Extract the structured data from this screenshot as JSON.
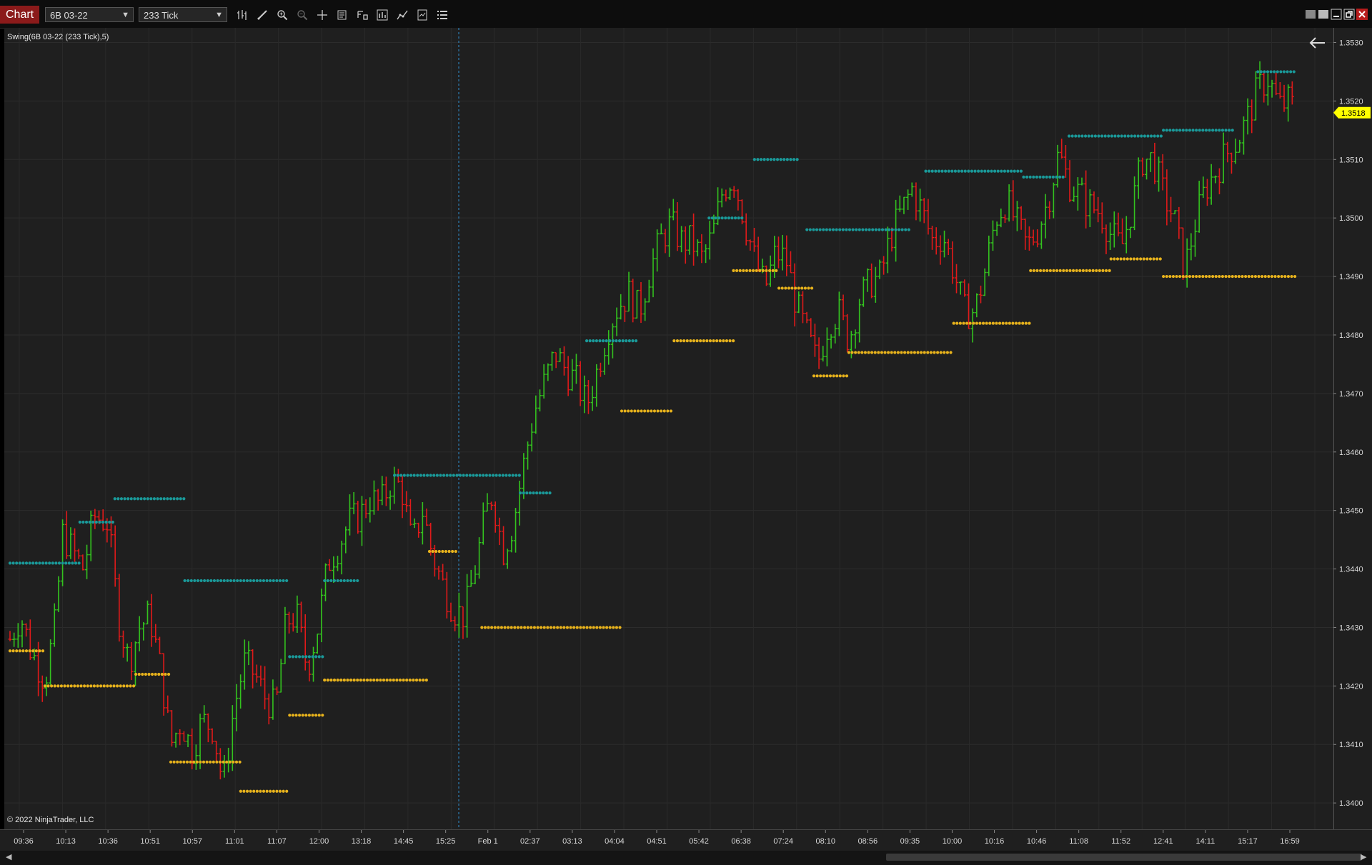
{
  "toolbar": {
    "tab_label": "Chart",
    "instrument": "6B 03-22",
    "bar_type": "233 Tick",
    "tools": [
      "bar-type-icon",
      "draw-line-icon",
      "zoom-in-icon",
      "zoom-out-icon",
      "crosshair-icon",
      "data-box-icon",
      "properties-icon",
      "strategies-icon",
      "indicators-icon",
      "templates-icon",
      "list-icon"
    ]
  },
  "chart": {
    "indicator_label": "Swing(6B 03-22 (233 Tick),5)",
    "copyright": "© 2022 NinjaTrader, LLC",
    "current_price": "1.3518",
    "colors": {
      "background": "#1f1f1f",
      "up": "#33c21f",
      "down": "#e01a1a",
      "swing_high": "#1a9a9a",
      "swing_low": "#e8b31c",
      "price_marker": "#ffff00"
    }
  },
  "chart_data": {
    "type": "ohlc",
    "y_ticks": [
      "1.3530",
      "1.3520",
      "1.3510",
      "1.3500",
      "1.3490",
      "1.3480",
      "1.3470",
      "1.3460",
      "1.3450",
      "1.3440",
      "1.3430",
      "1.3420",
      "1.3410",
      "1.3400"
    ],
    "ylim": [
      1.33955,
      1.35325
    ],
    "x_ticks": [
      "09:36",
      "10:13",
      "10:36",
      "10:51",
      "10:57",
      "11:01",
      "11:07",
      "12:00",
      "13:18",
      "14:45",
      "15:25",
      "Feb 1",
      "02:37",
      "03:13",
      "04:04",
      "04:51",
      "05:42",
      "06:38",
      "07:24",
      "08:10",
      "08:56",
      "09:35",
      "10:00",
      "10:16",
      "10:46",
      "11:08",
      "11:52",
      "12:41",
      "14:11",
      "15:17",
      "16:59"
    ],
    "n_bars": 318,
    "price_path": [
      [
        0,
        1.3428
      ],
      [
        3,
        1.3432
      ],
      [
        6,
        1.3426
      ],
      [
        10,
        1.3421
      ],
      [
        13,
        1.3431
      ],
      [
        15,
        1.3446
      ],
      [
        18,
        1.3443
      ],
      [
        21,
        1.344
      ],
      [
        24,
        1.3449
      ],
      [
        28,
        1.3448
      ],
      [
        31,
        1.3432
      ],
      [
        34,
        1.3424
      ],
      [
        37,
        1.343
      ],
      [
        40,
        1.3432
      ],
      [
        43,
        1.3423
      ],
      [
        46,
        1.341
      ],
      [
        49,
        1.3414
      ],
      [
        52,
        1.3409
      ],
      [
        55,
        1.3414
      ],
      [
        58,
        1.3413
      ],
      [
        61,
        1.3403
      ],
      [
        64,
        1.3416
      ],
      [
        67,
        1.3424
      ],
      [
        70,
        1.3422
      ],
      [
        73,
        1.3418
      ],
      [
        76,
        1.3416
      ],
      [
        79,
        1.3431
      ],
      [
        82,
        1.3432
      ],
      [
        85,
        1.3423
      ],
      [
        88,
        1.343
      ],
      [
        91,
        1.3441
      ],
      [
        94,
        1.3444
      ],
      [
        97,
        1.3448
      ],
      [
        100,
        1.3449
      ],
      [
        103,
        1.3452
      ],
      [
        106,
        1.3451
      ],
      [
        109,
        1.3455
      ],
      [
        112,
        1.3454
      ],
      [
        115,
        1.3444
      ],
      [
        118,
        1.345
      ],
      [
        121,
        1.3442
      ],
      [
        124,
        1.3437
      ],
      [
        127,
        1.3433
      ],
      [
        130,
        1.3432
      ],
      [
        133,
        1.344
      ],
      [
        136,
        1.3449
      ],
      [
        138,
        1.3453
      ],
      [
        141,
        1.3443
      ],
      [
        144,
        1.3448
      ],
      [
        147,
        1.3458
      ],
      [
        150,
        1.3467
      ],
      [
        153,
        1.3472
      ],
      [
        156,
        1.3477
      ],
      [
        159,
        1.3474
      ],
      [
        162,
        1.3472
      ],
      [
        165,
        1.3468
      ],
      [
        168,
        1.3474
      ],
      [
        171,
        1.3481
      ],
      [
        174,
        1.3485
      ],
      [
        177,
        1.3487
      ],
      [
        180,
        1.3484
      ],
      [
        183,
        1.3491
      ],
      [
        186,
        1.3496
      ],
      [
        189,
        1.3499
      ],
      [
        192,
        1.3496
      ],
      [
        195,
        1.3496
      ],
      [
        198,
        1.3493
      ],
      [
        201,
        1.3497
      ],
      [
        204,
        1.3505
      ],
      [
        207,
        1.3507
      ],
      [
        210,
        1.35
      ],
      [
        213,
        1.3493
      ],
      [
        216,
        1.3488
      ],
      [
        219,
        1.3494
      ],
      [
        222,
        1.3493
      ],
      [
        225,
        1.3485
      ],
      [
        228,
        1.348
      ],
      [
        231,
        1.3475
      ],
      [
        234,
        1.3482
      ],
      [
        237,
        1.3484
      ],
      [
        240,
        1.3479
      ],
      [
        243,
        1.3486
      ],
      [
        246,
        1.3489
      ],
      [
        249,
        1.349
      ],
      [
        252,
        1.3497
      ],
      [
        255,
        1.3501
      ],
      [
        258,
        1.3505
      ],
      [
        261,
        1.3501
      ],
      [
        264,
        1.3496
      ],
      [
        267,
        1.3497
      ],
      [
        270,
        1.3491
      ],
      [
        273,
        1.3484
      ],
      [
        276,
        1.3484
      ],
      [
        279,
        1.3491
      ],
      [
        282,
        1.35
      ],
      [
        285,
        1.3503
      ],
      [
        288,
        1.3499
      ],
      [
        291,
        1.3495
      ],
      [
        294,
        1.3498
      ],
      [
        297,
        1.3503
      ],
      [
        300,
        1.3511
      ],
      [
        303,
        1.3506
      ],
      [
        306,
        1.3504
      ],
      [
        309,
        1.3502
      ],
      [
        312,
        1.3501
      ],
      [
        315,
        1.3497
      ],
      [
        318,
        1.3495
      ],
      [
        321,
        1.3502
      ],
      [
        324,
        1.351
      ],
      [
        327,
        1.351
      ],
      [
        330,
        1.3504
      ],
      [
        333,
        1.35
      ],
      [
        336,
        1.3491
      ],
      [
        339,
        1.3499
      ],
      [
        342,
        1.3505
      ],
      [
        345,
        1.3508
      ],
      [
        348,
        1.3511
      ],
      [
        351,
        1.3513
      ],
      [
        354,
        1.3517
      ],
      [
        357,
        1.3522
      ],
      [
        360,
        1.3524
      ],
      [
        363,
        1.3519
      ],
      [
        366,
        1.352
      ],
      [
        368,
        1.3518
      ]
    ],
    "swing_highs": [
      {
        "value": 1.3441,
        "from": 0,
        "to": 20
      },
      {
        "value": 1.3448,
        "from": 20,
        "to": 30
      },
      {
        "value": 1.3452,
        "from": 30,
        "to": 50
      },
      {
        "value": 1.3438,
        "from": 50,
        "to": 80
      },
      {
        "value": 1.3425,
        "from": 80,
        "to": 90
      },
      {
        "value": 1.3438,
        "from": 90,
        "to": 100
      },
      {
        "value": 1.3456,
        "from": 110,
        "to": 146
      },
      {
        "value": 1.3453,
        "from": 146,
        "to": 155
      },
      {
        "value": 1.3479,
        "from": 165,
        "to": 180
      },
      {
        "value": 1.35,
        "from": 200,
        "to": 210
      },
      {
        "value": 1.351,
        "from": 213,
        "to": 226
      },
      {
        "value": 1.3498,
        "from": 228,
        "to": 258
      },
      {
        "value": 1.3508,
        "from": 262,
        "to": 290
      },
      {
        "value": 1.3507,
        "from": 290,
        "to": 302
      },
      {
        "value": 1.3514,
        "from": 303,
        "to": 330
      },
      {
        "value": 1.3515,
        "from": 330,
        "to": 350
      },
      {
        "value": 1.3525,
        "from": 357,
        "to": 368
      }
    ],
    "swing_lows": [
      {
        "value": 1.3426,
        "from": 0,
        "to": 10
      },
      {
        "value": 1.342,
        "from": 10,
        "to": 36
      },
      {
        "value": 1.3422,
        "from": 36,
        "to": 46
      },
      {
        "value": 1.3407,
        "from": 46,
        "to": 66
      },
      {
        "value": 1.3402,
        "from": 66,
        "to": 80
      },
      {
        "value": 1.3415,
        "from": 80,
        "to": 90
      },
      {
        "value": 1.3421,
        "from": 90,
        "to": 120
      },
      {
        "value": 1.3443,
        "from": 120,
        "to": 128
      },
      {
        "value": 1.343,
        "from": 135,
        "to": 175
      },
      {
        "value": 1.3467,
        "from": 175,
        "to": 190
      },
      {
        "value": 1.3479,
        "from": 190,
        "to": 207
      },
      {
        "value": 1.3491,
        "from": 207,
        "to": 220
      },
      {
        "value": 1.3488,
        "from": 220,
        "to": 230
      },
      {
        "value": 1.3473,
        "from": 230,
        "to": 240
      },
      {
        "value": 1.3477,
        "from": 240,
        "to": 270
      },
      {
        "value": 1.3482,
        "from": 270,
        "to": 292
      },
      {
        "value": 1.3491,
        "from": 292,
        "to": 315
      },
      {
        "value": 1.3493,
        "from": 315,
        "to": 330
      },
      {
        "value": 1.349,
        "from": 330,
        "to": 368
      }
    ]
  }
}
